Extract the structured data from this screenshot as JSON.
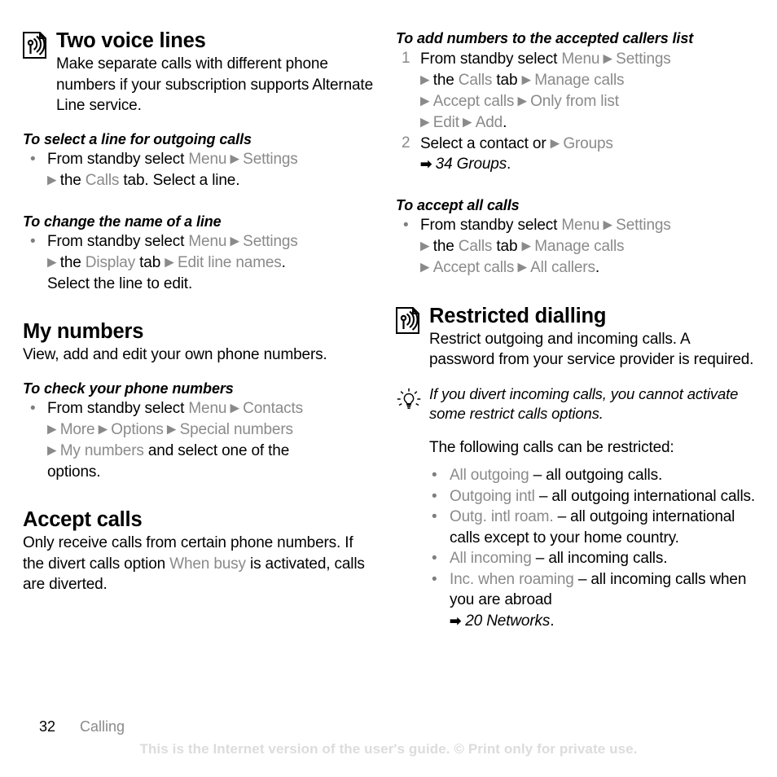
{
  "document": {
    "page_number": "32",
    "chapter": "Calling",
    "watermark": "This is the Internet version of the user's guide. © Print only for private use."
  },
  "icons": {
    "network_service": "network-service-icon",
    "tip": "lightbulb-tip-icon",
    "menu_arrow": "▶",
    "xref_arrow": "➡",
    "bullet": "•"
  },
  "left_column": {
    "section_two_voice_lines": {
      "title": "Two voice lines",
      "body": "Make separate calls with different phone numbers if your subscription supports Alternate Line service.",
      "procedures": [
        {
          "title": "To select a line for outgoing calls",
          "steps": [
            {
              "parts": [
                {
                  "t": "From standby select ",
                  "s": "plain"
                },
                {
                  "t": "Menu",
                  "s": "ui"
                },
                {
                  "t": " ▶ ",
                  "s": "arrow"
                },
                {
                  "t": "Settings",
                  "s": "ui"
                },
                {
                  "t": "▶ ",
                  "s": "arrow",
                  "break_before": true
                },
                {
                  "t": "the ",
                  "s": "plain"
                },
                {
                  "t": "Calls",
                  "s": "ui"
                },
                {
                  "t": " tab. Select a line.",
                  "s": "plain"
                }
              ]
            }
          ]
        },
        {
          "title": "To change the name of a line",
          "steps": [
            {
              "parts": [
                {
                  "t": "From standby select ",
                  "s": "plain"
                },
                {
                  "t": "Menu",
                  "s": "ui"
                },
                {
                  "t": " ▶ ",
                  "s": "arrow"
                },
                {
                  "t": "Settings",
                  "s": "ui"
                },
                {
                  "t": "▶ ",
                  "s": "arrow",
                  "break_before": true
                },
                {
                  "t": "the ",
                  "s": "plain"
                },
                {
                  "t": "Display",
                  "s": "ui"
                },
                {
                  "t": " tab ",
                  "s": "plain"
                },
                {
                  "t": "▶ ",
                  "s": "arrow"
                },
                {
                  "t": "Edit line names",
                  "s": "ui"
                },
                {
                  "t": ".",
                  "s": "plain"
                },
                {
                  "t": "Select the line to edit.",
                  "s": "plain",
                  "break_before": true
                }
              ]
            }
          ]
        }
      ]
    },
    "section_my_numbers": {
      "title": "My numbers",
      "body": "View, add and edit your own phone numbers.",
      "procedures": [
        {
          "title": "To check your phone numbers",
          "steps": [
            {
              "parts": [
                {
                  "t": "From standby select ",
                  "s": "plain"
                },
                {
                  "t": "Menu",
                  "s": "ui"
                },
                {
                  "t": " ▶ ",
                  "s": "arrow"
                },
                {
                  "t": "Contacts",
                  "s": "ui"
                },
                {
                  "t": "▶ ",
                  "s": "arrow",
                  "break_before": true
                },
                {
                  "t": "More",
                  "s": "ui"
                },
                {
                  "t": " ▶ ",
                  "s": "arrow"
                },
                {
                  "t": "Options",
                  "s": "ui"
                },
                {
                  "t": " ▶ ",
                  "s": "arrow"
                },
                {
                  "t": "Special numbers",
                  "s": "ui"
                },
                {
                  "t": "▶ ",
                  "s": "arrow",
                  "break_before": true
                },
                {
                  "t": "My numbers",
                  "s": "ui"
                },
                {
                  "t": " and select one of the",
                  "s": "plain"
                },
                {
                  "t": "options.",
                  "s": "plain",
                  "break_before": true
                }
              ]
            }
          ]
        }
      ]
    },
    "section_accept_calls": {
      "title": "Accept calls",
      "body_parts": [
        {
          "t": "Only receive calls from certain phone numbers. If the divert calls option ",
          "s": "plain"
        },
        {
          "t": "When busy",
          "s": "ui"
        },
        {
          "t": " is activated, calls are diverted.",
          "s": "plain"
        }
      ]
    }
  },
  "right_column": {
    "procedure_add_numbers": {
      "title": "To add numbers to the accepted callers list",
      "numbered_steps": [
        {
          "num": "1",
          "parts": [
            {
              "t": "From standby select ",
              "s": "plain"
            },
            {
              "t": "Menu",
              "s": "ui"
            },
            {
              "t": " ▶ ",
              "s": "arrow"
            },
            {
              "t": "Settings",
              "s": "ui"
            },
            {
              "t": "▶ ",
              "s": "arrow",
              "break_before": true
            },
            {
              "t": "the ",
              "s": "plain"
            },
            {
              "t": "Calls",
              "s": "ui"
            },
            {
              "t": " tab ",
              "s": "plain"
            },
            {
              "t": "▶ ",
              "s": "arrow"
            },
            {
              "t": "Manage calls",
              "s": "ui"
            },
            {
              "t": "▶ ",
              "s": "arrow",
              "break_before": true
            },
            {
              "t": "Accept calls",
              "s": "ui"
            },
            {
              "t": " ▶ ",
              "s": "arrow"
            },
            {
              "t": "Only from list",
              "s": "ui"
            },
            {
              "t": "▶ ",
              "s": "arrow",
              "break_before": true
            },
            {
              "t": "Edit",
              "s": "ui"
            },
            {
              "t": " ▶ ",
              "s": "arrow"
            },
            {
              "t": "Add",
              "s": "ui"
            },
            {
              "t": ".",
              "s": "plain"
            }
          ]
        },
        {
          "num": "2",
          "parts": [
            {
              "t": "Select a contact or ",
              "s": "plain"
            },
            {
              "t": "▶ ",
              "s": "arrow"
            },
            {
              "t": "Groups",
              "s": "ui"
            },
            {
              "t": "➡ ",
              "s": "xref-arrow",
              "break_before": true
            },
            {
              "t": "34 Groups",
              "s": "xref"
            },
            {
              "t": ".",
              "s": "plain"
            }
          ]
        }
      ]
    },
    "procedure_accept_all": {
      "title": "To accept all calls",
      "steps": [
        {
          "parts": [
            {
              "t": "From standby select ",
              "s": "plain"
            },
            {
              "t": "Menu",
              "s": "ui"
            },
            {
              "t": " ▶ ",
              "s": "arrow"
            },
            {
              "t": "Settings",
              "s": "ui"
            },
            {
              "t": "▶ ",
              "s": "arrow",
              "break_before": true
            },
            {
              "t": "the ",
              "s": "plain"
            },
            {
              "t": "Calls",
              "s": "ui"
            },
            {
              "t": " tab ",
              "s": "plain"
            },
            {
              "t": "▶ ",
              "s": "arrow"
            },
            {
              "t": "Manage calls",
              "s": "ui"
            },
            {
              "t": "▶ ",
              "s": "arrow",
              "break_before": true
            },
            {
              "t": "Accept calls",
              "s": "ui"
            },
            {
              "t": " ▶ ",
              "s": "arrow"
            },
            {
              "t": "All callers",
              "s": "ui"
            },
            {
              "t": ".",
              "s": "plain"
            }
          ]
        }
      ]
    },
    "section_restricted_dialling": {
      "title": "Restricted dialling",
      "body": "Restrict outgoing and incoming calls. A password from your service provider is required.",
      "tip": "If you divert incoming calls, you cannot activate some restrict calls options.",
      "intro": "The following calls can be restricted:",
      "restrictions": [
        {
          "term": "All outgoing",
          "desc": " – all outgoing calls."
        },
        {
          "term": "Outgoing intl",
          "desc": " – all outgoing international calls."
        },
        {
          "term": "Outg. intl roam.",
          "desc": " – all outgoing international calls except to your home country."
        },
        {
          "term": "All incoming",
          "desc": " – all incoming calls."
        },
        {
          "term": "Inc. when roaming",
          "desc": " – all incoming calls when you are abroad",
          "xref_arrow": "➡",
          "xref": "20 Networks",
          "xref_tail": "."
        }
      ]
    }
  },
  "colors": {
    "text": "#000000",
    "ui_term": "#8a8a8a",
    "watermark": "#dcdcdc",
    "background": "#ffffff"
  }
}
